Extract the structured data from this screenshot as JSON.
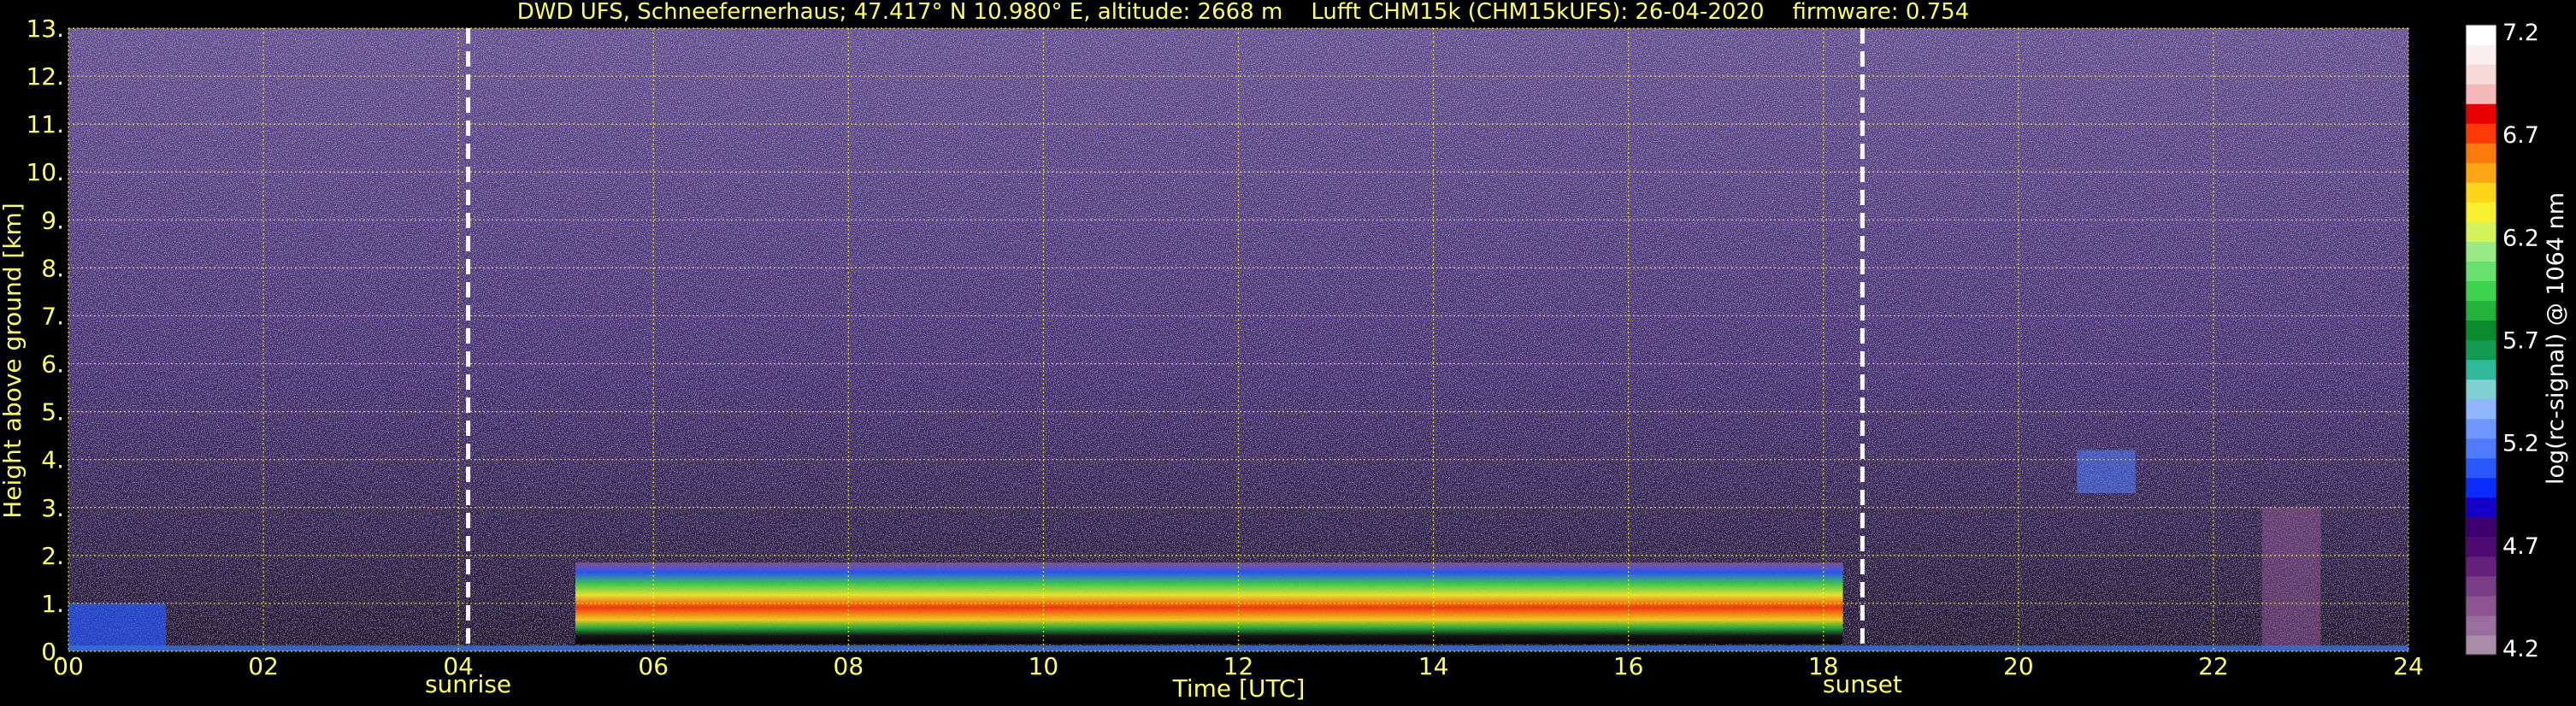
{
  "title": "DWD UFS, Schneefernerhaus; 47.417° N 10.980° E, altitude: 2668 m    Lufft CHM15k (CHM15kUFS): 26-04-2020    firmware: 0.754",
  "chart_data": {
    "type": "heatmap",
    "xlabel": "Time [UTC]",
    "ylabel": "Height above ground [km]",
    "xlim": [
      0,
      24
    ],
    "ylim": [
      0,
      13
    ],
    "xticks": [
      "00",
      "02",
      "04",
      "06",
      "08",
      "10",
      "12",
      "14",
      "16",
      "18",
      "20",
      "22",
      "24"
    ],
    "yticks": [
      "0.",
      "1.",
      "2.",
      "3.",
      "4.",
      "5.",
      "6.",
      "7.",
      "8.",
      "9.",
      "10.",
      "11.",
      "12.",
      "13."
    ],
    "grid": true,
    "annotations": [
      {
        "label": "sunrise",
        "time": 4.1
      },
      {
        "label": "sunset",
        "time": 18.4
      }
    ],
    "colorbar": {
      "label": "log(rc-signal) @ 1064 nm",
      "min": 4.2,
      "max": 7.2,
      "ticks": [
        "7.2",
        "6.7",
        "6.2",
        "5.7",
        "5.2",
        "4.7",
        "4.2"
      ],
      "colors": [
        "#a98ca8",
        "#9b6f9d",
        "#8c5590",
        "#7a3d86",
        "#65207c",
        "#500a74",
        "#3e006e",
        "#1400c8",
        "#0a2cff",
        "#2a58ff",
        "#4f7cff",
        "#6f98ff",
        "#8fb6ff",
        "#7fd0d2",
        "#2fb99a",
        "#129a52",
        "#0a8a2a",
        "#23b33c",
        "#3ed24f",
        "#67e06e",
        "#98ea86",
        "#d4f25a",
        "#f7f02e",
        "#ffd51a",
        "#ffa712",
        "#ff7a0d",
        "#ff3a08",
        "#e80000",
        "#f4b8b8",
        "#f7d8d8",
        "#fbeeee",
        "#ffffff"
      ]
    }
  }
}
